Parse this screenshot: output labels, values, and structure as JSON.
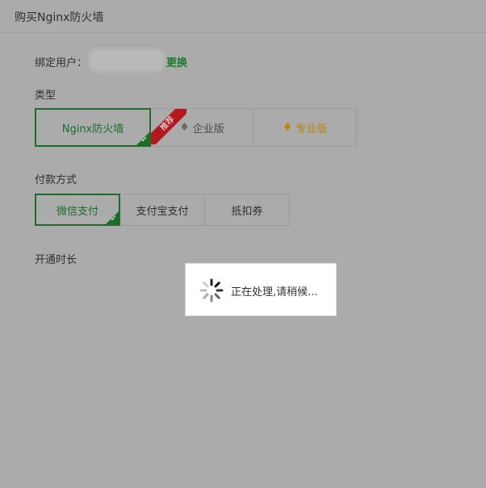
{
  "dialog": {
    "title": "购买Nginx防火墙"
  },
  "user": {
    "label": "绑定用户：",
    "change_link": "更换"
  },
  "type": {
    "label": "类型",
    "options": [
      {
        "label": "Nginx防火墙",
        "selected": true
      },
      {
        "label": "企业版",
        "ribbon": "推荐",
        "icon": "diamond-icon"
      },
      {
        "label": "专业版",
        "icon": "diamond-icon"
      }
    ]
  },
  "payment": {
    "label": "付款方式",
    "options": [
      {
        "label": "微信支付",
        "selected": true
      },
      {
        "label": "支付宝支付"
      },
      {
        "label": "抵扣券"
      }
    ]
  },
  "duration": {
    "label": "开通时长"
  },
  "loading": {
    "text": "正在处理,请稍候..."
  },
  "colors": {
    "accent_green": "#1c6c2a",
    "link_green": "#1a7a2c",
    "ribbon_red": "#b3181e",
    "gold": "#b8860b",
    "overlay_gray": "#ababab"
  }
}
